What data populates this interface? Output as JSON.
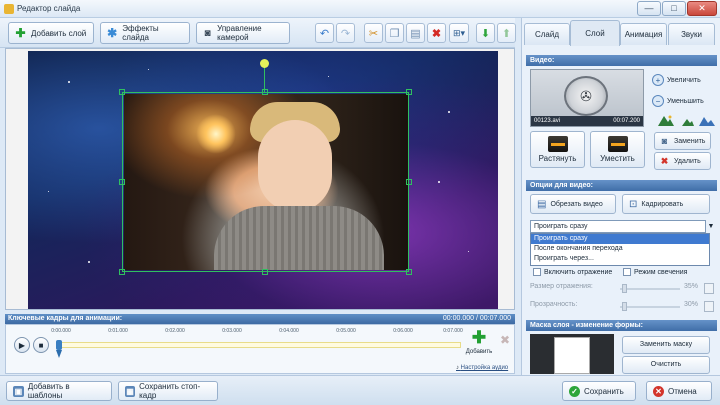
{
  "window": {
    "title": "Редактор слайда",
    "min": "—",
    "max": "□",
    "close": "✕"
  },
  "toolbar": {
    "add_layer": "Добавить слой",
    "slide_effects": "Эффекты слайда",
    "camera_control": "Управление камерой"
  },
  "canvas": {
    "colors": {
      "selection": "#30c060",
      "rotation_handle": "#e4f25a"
    }
  },
  "keyframes": {
    "title": "Ключевые кадры для анимации:",
    "time": "00:00.000 / 00:07.000",
    "ticks": [
      "0:00.000",
      "0:01.000",
      "0:02.000",
      "0:03.000",
      "0:04.000",
      "0:05.000",
      "0:06.000",
      "0:07.000"
    ],
    "add_label": "Добавить",
    "audio_settings": "Настройка аудио"
  },
  "footer": {
    "add_to_templates": "Добавить в шаблоны",
    "save_frame": "Сохранить стоп-кадр",
    "save": "Сохранить",
    "cancel": "Отмена"
  },
  "tabs": [
    "Слайд",
    "Слой",
    "Анимация",
    "Звуки"
  ],
  "active_tab": "Слой",
  "video": {
    "header": "Видео:",
    "filename": "00123.avi",
    "duration": "00:07.200",
    "increase": "Увеличить",
    "decrease": "Уменьшить",
    "stretch": "Растянуть",
    "fit": "Уместить",
    "replace": "Заменить",
    "delete": "Удалить"
  },
  "video_options": {
    "header": "Опции для видео:",
    "trim": "Обрезать видео",
    "crop": "Кадрировать",
    "play_select": "Проиграть сразу",
    "dropdown_options": [
      "Проиграть сразу",
      "После окончания перехода",
      "Проиграть через..."
    ],
    "reflection": "Включить отражение",
    "glow": "Режим свечения",
    "reflection_size_label": "Размер отражения:",
    "reflection_size_value": "35%",
    "transparency_label": "Прозрачность:",
    "transparency_value": "30%"
  },
  "mask": {
    "header": "Маска слоя - изменение формы:",
    "replace_mask": "Заменить маску",
    "clear": "Очистить"
  }
}
